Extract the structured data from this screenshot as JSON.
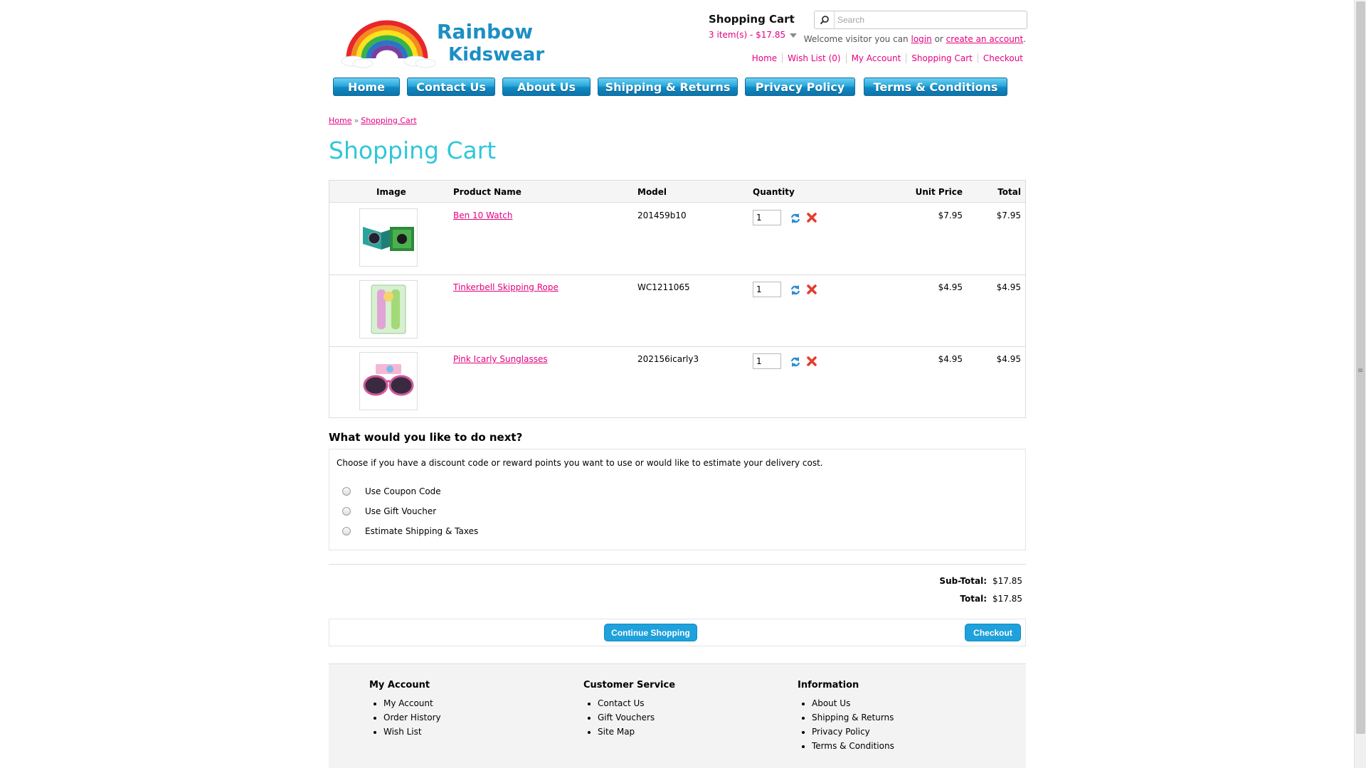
{
  "brand": {
    "name_line1": "Rainbow",
    "name_line2": "Kidswear"
  },
  "cart_summary": {
    "heading": "Shopping Cart",
    "items_text": "3 item(s) - $17.85"
  },
  "search": {
    "placeholder": "Search"
  },
  "welcome": {
    "prefix": "Welcome visitor you can",
    "login": "login",
    "or": "or",
    "create": "create an account",
    "suffix": "."
  },
  "top_links": [
    "Home",
    "Wish List (0)",
    "My Account",
    "Shopping Cart",
    "Checkout"
  ],
  "menu": [
    "Home",
    "Contact Us",
    "About Us",
    "Shipping & Returns",
    "Privacy Policy",
    "Terms & Conditions"
  ],
  "breadcrumb": {
    "home": "Home",
    "separator": "»",
    "current": "Shopping Cart"
  },
  "page_title": "Shopping Cart",
  "cart": {
    "headers": {
      "image": "Image",
      "name": "Product Name",
      "model": "Model",
      "quantity": "Quantity",
      "unit_price": "Unit Price",
      "total": "Total"
    },
    "rows": [
      {
        "name": "Ben 10 Watch",
        "model": "201459b10",
        "qty": "1",
        "unit_price": "$7.95",
        "total": "$7.95"
      },
      {
        "name": "Tinkerbell Skipping Rope",
        "model": "WC1211065",
        "qty": "1",
        "unit_price": "$4.95",
        "total": "$4.95"
      },
      {
        "name": "Pink Icarly Sunglasses",
        "model": "202156icarly3",
        "qty": "1",
        "unit_price": "$4.95",
        "total": "$4.95"
      }
    ]
  },
  "next": {
    "title": "What would you like to do next?",
    "intro": "Choose if you have a discount code or reward points you want to use or would like to estimate your delivery cost.",
    "options": [
      "Use Coupon Code",
      "Use Gift Voucher",
      "Estimate Shipping & Taxes"
    ]
  },
  "totals": {
    "subtotal_label": "Sub-Total:",
    "subtotal": "$17.85",
    "total_label": "Total:",
    "total": "$17.85"
  },
  "buttons": {
    "continue": "Continue Shopping",
    "checkout": "Checkout"
  },
  "footer": {
    "my_account": {
      "title": "My Account",
      "links": [
        "My Account",
        "Order History",
        "Wish List"
      ]
    },
    "customer_service": {
      "title": "Customer Service",
      "links": [
        "Contact Us",
        "Gift Vouchers",
        "Site Map"
      ]
    },
    "information": {
      "title": "Information",
      "links": [
        "About Us",
        "Shipping & Returns",
        "Privacy Policy",
        "Terms & Conditions"
      ]
    }
  },
  "colors": {
    "accent_pink": "#e6007e",
    "title_cyan": "#31c7d8",
    "menu_blue": "#1288c2",
    "button_blue": "#1ea1dc"
  },
  "icons": [
    "search-icon",
    "update-icon",
    "remove-icon",
    "caret-down-icon"
  ]
}
